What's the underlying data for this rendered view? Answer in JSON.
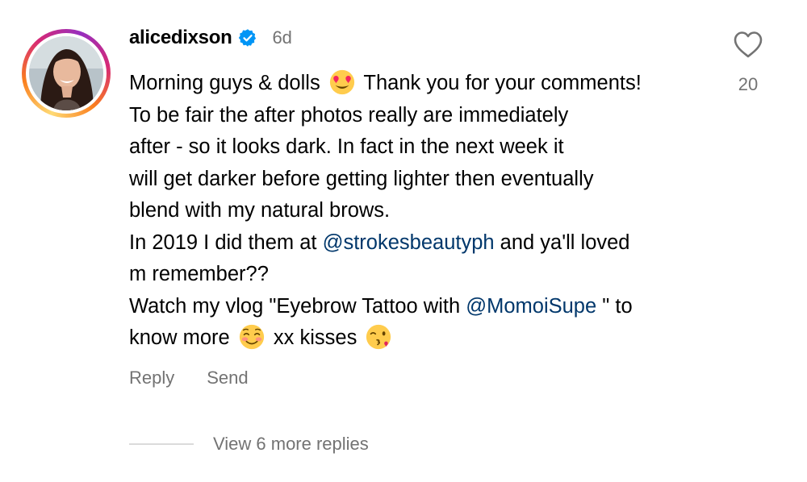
{
  "comment": {
    "username": "alicedixson",
    "timestamp": "6d",
    "verified_icon": "verified-badge-icon",
    "avatar_icon": "profile-photo",
    "lines": {
      "l1a": "Morning guys & dolls ",
      "l1b": " Thank you for your comments!",
      "l2": "To be fair the after photos really are immediately",
      "l3": "after - so it looks dark. In fact in the next week it",
      "l4": "will get darker before getting lighter then eventually",
      "l5": "blend with my natural brows.",
      "l6a": "In 2019 I did them at ",
      "l6_mention": "@strokesbeautyph",
      "l6b": " and ya'll loved",
      "l7": "m remember??",
      "l8a": "Watch my vlog \"Eyebrow Tattoo with ",
      "l8_mention": "@MomoiSupe",
      "l8b": " \" to",
      "l9a": "know more ",
      "l9b": " xx kisses "
    },
    "emojis": {
      "heart_eyes": "smiling-face-with-heart-eyes-emoji",
      "blush": "smiling-face-with-smiling-eyes-emoji",
      "kiss": "face-blowing-a-kiss-emoji"
    },
    "actions": {
      "reply_label": "Reply",
      "send_label": "Send"
    },
    "like": {
      "icon": "heart-icon",
      "count": "20"
    },
    "replies": {
      "label": "View 6 more replies"
    }
  },
  "colors": {
    "text": "#000000",
    "secondary_text": "#737373",
    "mention": "#00376b",
    "verified": "#0095f6",
    "divider": "#dbdbdb"
  }
}
